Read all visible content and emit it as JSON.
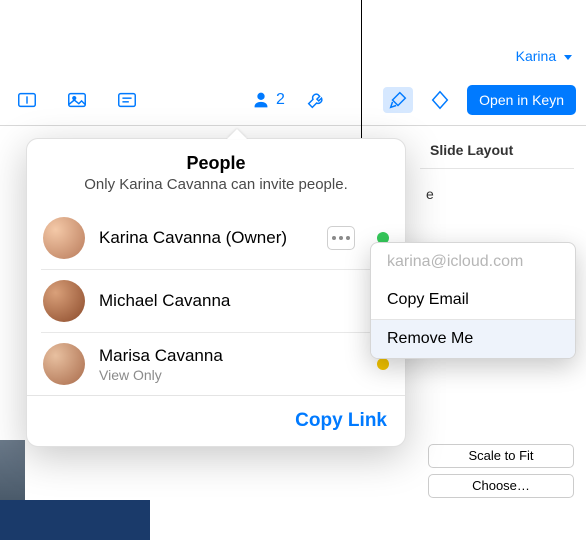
{
  "user_menu": {
    "name": "Karina"
  },
  "toolbar": {
    "collab_count": "2",
    "open_button": "Open in Keyn"
  },
  "inspector": {
    "section_label": "Slide Layout",
    "truncated_label": "e",
    "scale_label": "Scale to Fit",
    "choose_label": "Choose…"
  },
  "popover": {
    "title": "People",
    "subtitle": "Only Karina Cavanna can invite people.",
    "people": [
      {
        "name": "Karina Cavanna (Owner)",
        "role": "",
        "status": "green",
        "has_more": true
      },
      {
        "name": "Michael Cavanna",
        "role": "",
        "status": "",
        "has_more": false
      },
      {
        "name": "Marisa Cavanna",
        "role": "View Only",
        "status": "yellow",
        "has_more": false
      }
    ],
    "copy_link": "Copy Link"
  },
  "context_menu": {
    "email": "karina@icloud.com",
    "copy_email": "Copy Email",
    "remove_me": "Remove Me"
  }
}
